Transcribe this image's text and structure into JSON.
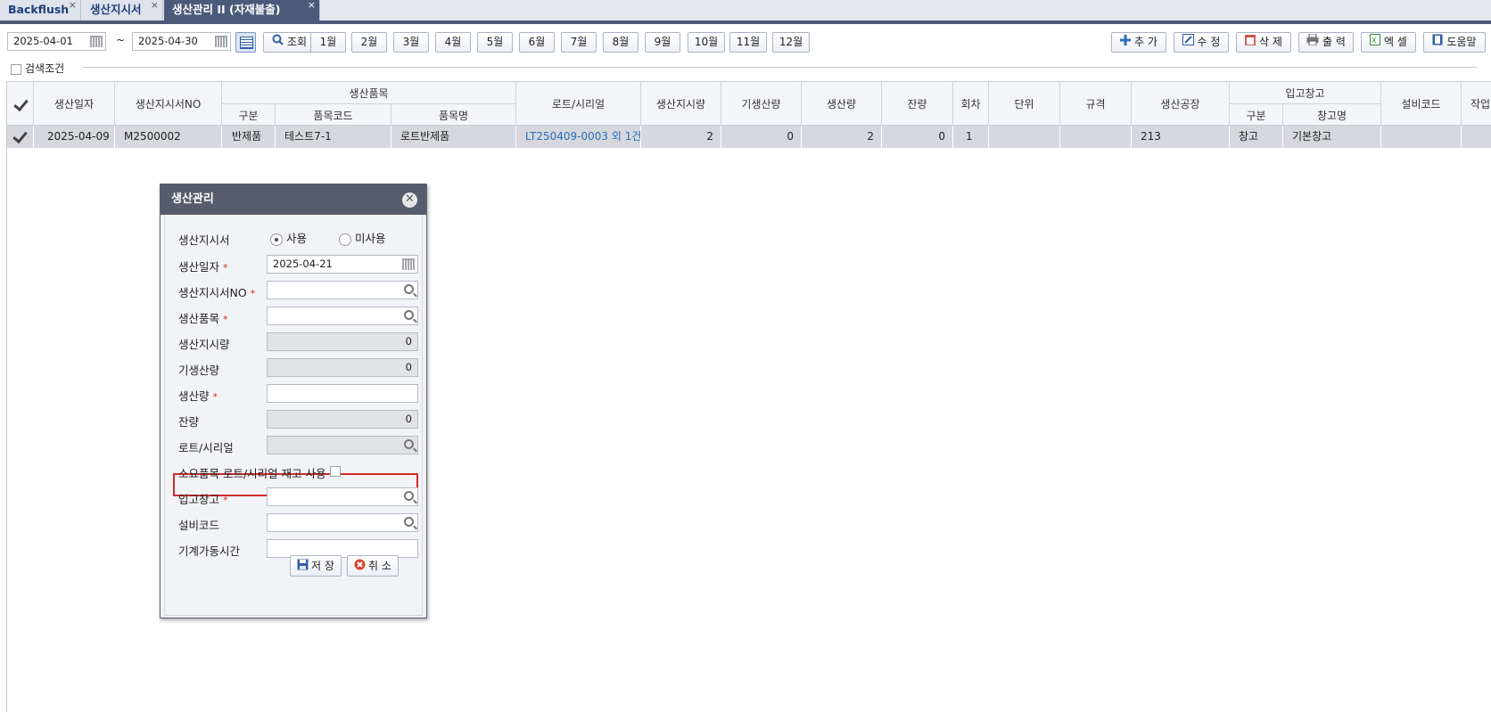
{
  "tabs": [
    {
      "label": "Backflush",
      "close": "×"
    },
    {
      "label": "생산지시서",
      "close": "×"
    },
    {
      "label": "생산관리 II (자재불출)",
      "close": "×"
    }
  ],
  "toolbar": {
    "date_from": "2025-04-01",
    "date_to": "2025-04-30",
    "tilde": "~",
    "search_label": "조회",
    "months": [
      "1월",
      "2월",
      "3월",
      "4월",
      "5월",
      "6월",
      "7월",
      "8월",
      "9월",
      "10월",
      "11월",
      "12월"
    ],
    "add_label": "추 가",
    "edit_label": "수 정",
    "delete_label": "삭 제",
    "print_label": "출 력",
    "excel_label": "엑 셀",
    "help_label": "도움말"
  },
  "search_condition": "검색조건",
  "grid": {
    "headers": {
      "date": "생산일자",
      "order_no": "생산지시서NO",
      "item_group": "생산품목",
      "item_type": "구분",
      "item_code": "품목코드",
      "item_name": "품목명",
      "lot": "로트/시리얼",
      "order_qty": "생산지시량",
      "prev_qty": "기생산량",
      "prod_qty": "생산량",
      "remain": "잔량",
      "round": "회차",
      "unit": "단위",
      "spec": "규격",
      "plant": "생산공장",
      "wh_group": "입고창고",
      "wh_type": "구분",
      "wh_name": "창고명",
      "equip": "설비코드",
      "work": "작업"
    },
    "rows": [
      {
        "date": "2025-04-09",
        "order_no": "M2500002",
        "item_type": "반제품",
        "item_code": "테스트7-1",
        "item_name": "로트반제품",
        "lot": "LT250409-0003 외 1건",
        "order_qty": "2",
        "prev_qty": "0",
        "prod_qty": "2",
        "remain": "0",
        "round": "1",
        "unit": "",
        "spec": "",
        "plant": "213",
        "wh_type": "창고",
        "wh_name": "기본창고",
        "equip": ""
      }
    ]
  },
  "dialog": {
    "title": "생산관리",
    "close": "✕",
    "fields": {
      "order_label": "생산지시서",
      "radio_use": "사용",
      "radio_nouse": "미사용",
      "date_label": "생산일자",
      "date_value": "2025-04-21",
      "order_no_label": "생산지시서NO",
      "item_label": "생산품목",
      "order_qty_label": "생산지시량",
      "order_qty_value": "0",
      "prev_qty_label": "기생산량",
      "prev_qty_value": "0",
      "prod_qty_label": "생산량",
      "remain_label": "잔량",
      "remain_value": "0",
      "lot_label": "로트/시리얼",
      "consume_label": "소요품목 로트/시리얼 재고 사용",
      "wh_label": "입고창고",
      "equip_label": "설비코드",
      "machine_time_label": "기계가동시간"
    },
    "required_mark": "*",
    "save_label": "저 장",
    "cancel_label": "취 소"
  }
}
